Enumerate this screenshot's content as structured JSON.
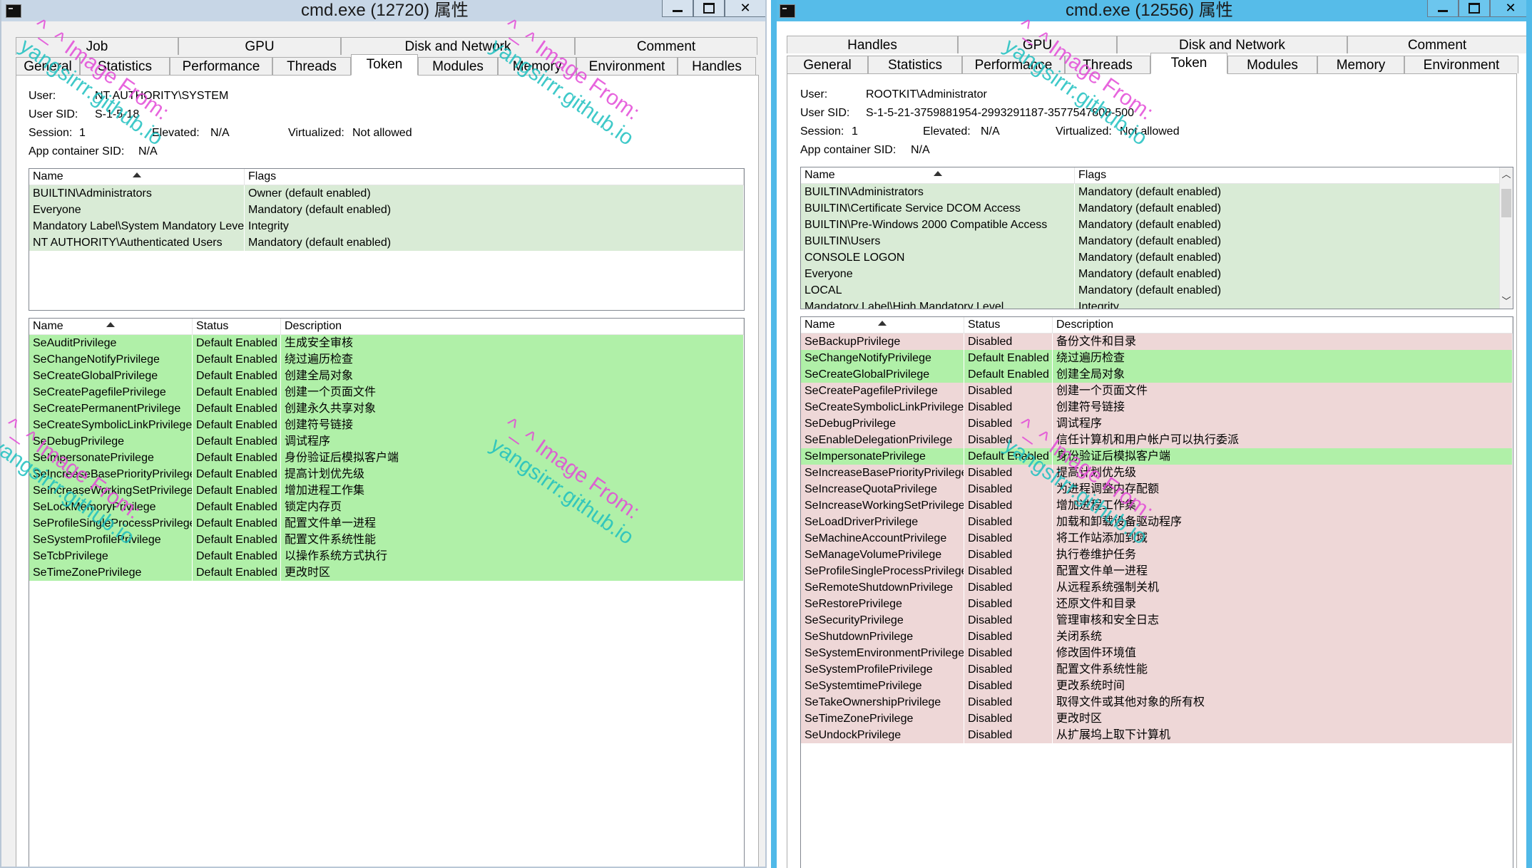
{
  "left": {
    "title": "cmd.exe (12720) 属性",
    "tabs_top": [
      "Job",
      "GPU",
      "Disk and Network",
      "Comment"
    ],
    "tabs_bottom": [
      "General",
      "Statistics",
      "Performance",
      "Threads",
      "Token",
      "Modules",
      "Memory",
      "Environment",
      "Handles"
    ],
    "active_tab": "Token",
    "user_label": "User:",
    "user_value": "NT AUTHORITY\\SYSTEM",
    "sid_label": "User SID:",
    "sid_value": "S-1-5-18",
    "session_label": "Session:",
    "session_value": "1",
    "elevated_label": "Elevated:",
    "elevated_value": "N/A",
    "virtualized_label": "Virtualized:",
    "virtualized_value": "Not allowed",
    "appsid_label": "App container SID:",
    "appsid_value": "N/A",
    "groups": {
      "headers": [
        "Name",
        "Flags"
      ],
      "rows": [
        {
          "name": "BUILTIN\\Administrators",
          "flags": "Owner (default enabled)"
        },
        {
          "name": "Everyone",
          "flags": "Mandatory (default enabled)"
        },
        {
          "name": "Mandatory Label\\System Mandatory Level",
          "flags": "Integrity"
        },
        {
          "name": "NT AUTHORITY\\Authenticated Users",
          "flags": "Mandatory (default enabled)"
        }
      ]
    },
    "privileges": {
      "headers": [
        "Name",
        "Status",
        "Description"
      ],
      "rows": [
        {
          "name": "SeAuditPrivilege",
          "status": "Default Enabled",
          "desc": "生成安全审核",
          "state": "enabled"
        },
        {
          "name": "SeChangeNotifyPrivilege",
          "status": "Default Enabled",
          "desc": "绕过遍历检查",
          "state": "enabled"
        },
        {
          "name": "SeCreateGlobalPrivilege",
          "status": "Default Enabled",
          "desc": "创建全局对象",
          "state": "enabled"
        },
        {
          "name": "SeCreatePagefilePrivilege",
          "status": "Default Enabled",
          "desc": "创建一个页面文件",
          "state": "enabled"
        },
        {
          "name": "SeCreatePermanentPrivilege",
          "status": "Default Enabled",
          "desc": "创建永久共享对象",
          "state": "enabled"
        },
        {
          "name": "SeCreateSymbolicLinkPrivilege",
          "status": "Default Enabled",
          "desc": "创建符号链接",
          "state": "enabled"
        },
        {
          "name": "SeDebugPrivilege",
          "status": "Default Enabled",
          "desc": "调试程序",
          "state": "enabled"
        },
        {
          "name": "SeImpersonatePrivilege",
          "status": "Default Enabled",
          "desc": "身份验证后模拟客户端",
          "state": "enabled"
        },
        {
          "name": "SeIncreaseBasePriorityPrivilege",
          "status": "Default Enabled",
          "desc": "提高计划优先级",
          "state": "enabled"
        },
        {
          "name": "SeIncreaseWorkingSetPrivilege",
          "status": "Default Enabled",
          "desc": "增加进程工作集",
          "state": "enabled"
        },
        {
          "name": "SeLockMemoryPrivilege",
          "status": "Default Enabled",
          "desc": "锁定内存页",
          "state": "enabled"
        },
        {
          "name": "SeProfileSingleProcessPrivilege",
          "status": "Default Enabled",
          "desc": "配置文件单一进程",
          "state": "enabled"
        },
        {
          "name": "SeSystemProfilePrivilege",
          "status": "Default Enabled",
          "desc": "配置文件系统性能",
          "state": "enabled"
        },
        {
          "name": "SeTcbPrivilege",
          "status": "Default Enabled",
          "desc": "以操作系统方式执行",
          "state": "enabled"
        },
        {
          "name": "SeTimeZonePrivilege",
          "status": "Default Enabled",
          "desc": "更改时区",
          "state": "enabled"
        }
      ]
    }
  },
  "right": {
    "title": "cmd.exe (12556) 属性",
    "tabs_top": [
      "Handles",
      "GPU",
      "Disk and Network",
      "Comment"
    ],
    "tabs_bottom": [
      "General",
      "Statistics",
      "Performance",
      "Threads",
      "Token",
      "Modules",
      "Memory",
      "Environment"
    ],
    "active_tab": "Token",
    "user_label": "User:",
    "user_value": "ROOTKIT\\Administrator",
    "sid_label": "User SID:",
    "sid_value": "S-1-5-21-3759881954-2993291187-3577547808-500",
    "session_label": "Session:",
    "session_value": "1",
    "elevated_label": "Elevated:",
    "elevated_value": "N/A",
    "virtualized_label": "Virtualized:",
    "virtualized_value": "Not allowed",
    "appsid_label": "App container SID:",
    "appsid_value": "N/A",
    "groups": {
      "headers": [
        "Name",
        "Flags"
      ],
      "rows": [
        {
          "name": "BUILTIN\\Administrators",
          "flags": "Mandatory (default enabled)"
        },
        {
          "name": "BUILTIN\\Certificate Service DCOM Access",
          "flags": "Mandatory (default enabled)"
        },
        {
          "name": "BUILTIN\\Pre-Windows 2000 Compatible Access",
          "flags": "Mandatory (default enabled)"
        },
        {
          "name": "BUILTIN\\Users",
          "flags": "Mandatory (default enabled)"
        },
        {
          "name": "CONSOLE LOGON",
          "flags": "Mandatory (default enabled)"
        },
        {
          "name": "Everyone",
          "flags": "Mandatory (default enabled)"
        },
        {
          "name": "LOCAL",
          "flags": "Mandatory (default enabled)"
        },
        {
          "name": "Mandatory Label\\High Mandatory Level",
          "flags": "Integrity"
        }
      ]
    },
    "privileges": {
      "headers": [
        "Name",
        "Status",
        "Description"
      ],
      "rows": [
        {
          "name": "SeBackupPrivilege",
          "status": "Disabled",
          "desc": "备份文件和目录",
          "state": "disabled"
        },
        {
          "name": "SeChangeNotifyPrivilege",
          "status": "Default Enabled",
          "desc": "绕过遍历检查",
          "state": "enabled"
        },
        {
          "name": "SeCreateGlobalPrivilege",
          "status": "Default Enabled",
          "desc": "创建全局对象",
          "state": "enabled"
        },
        {
          "name": "SeCreatePagefilePrivilege",
          "status": "Disabled",
          "desc": "创建一个页面文件",
          "state": "disabled"
        },
        {
          "name": "SeCreateSymbolicLinkPrivilege",
          "status": "Disabled",
          "desc": "创建符号链接",
          "state": "disabled"
        },
        {
          "name": "SeDebugPrivilege",
          "status": "Disabled",
          "desc": "调试程序",
          "state": "disabled"
        },
        {
          "name": "SeEnableDelegationPrivilege",
          "status": "Disabled",
          "desc": "信任计算机和用户帐户可以执行委派",
          "state": "disabled"
        },
        {
          "name": "SeImpersonatePrivilege",
          "status": "Default Enabled",
          "desc": "身份验证后模拟客户端",
          "state": "enabled"
        },
        {
          "name": "SeIncreaseBasePriorityPrivilege",
          "status": "Disabled",
          "desc": "提高计划优先级",
          "state": "disabled"
        },
        {
          "name": "SeIncreaseQuotaPrivilege",
          "status": "Disabled",
          "desc": "为进程调整内存配额",
          "state": "disabled"
        },
        {
          "name": "SeIncreaseWorkingSetPrivilege",
          "status": "Disabled",
          "desc": "增加进程工作集",
          "state": "disabled"
        },
        {
          "name": "SeLoadDriverPrivilege",
          "status": "Disabled",
          "desc": "加载和卸载设备驱动程序",
          "state": "disabled"
        },
        {
          "name": "SeMachineAccountPrivilege",
          "status": "Disabled",
          "desc": "将工作站添加到域",
          "state": "disabled"
        },
        {
          "name": "SeManageVolumePrivilege",
          "status": "Disabled",
          "desc": "执行卷维护任务",
          "state": "disabled"
        },
        {
          "name": "SeProfileSingleProcessPrivilege",
          "status": "Disabled",
          "desc": "配置文件单一进程",
          "state": "disabled"
        },
        {
          "name": "SeRemoteShutdownPrivilege",
          "status": "Disabled",
          "desc": "从远程系统强制关机",
          "state": "disabled"
        },
        {
          "name": "SeRestorePrivilege",
          "status": "Disabled",
          "desc": "还原文件和目录",
          "state": "disabled"
        },
        {
          "name": "SeSecurityPrivilege",
          "status": "Disabled",
          "desc": "管理审核和安全日志",
          "state": "disabled"
        },
        {
          "name": "SeShutdownPrivilege",
          "status": "Disabled",
          "desc": "关闭系统",
          "state": "disabled"
        },
        {
          "name": "SeSystemEnvironmentPrivilege",
          "status": "Disabled",
          "desc": "修改固件环境值",
          "state": "disabled"
        },
        {
          "name": "SeSystemProfilePrivilege",
          "status": "Disabled",
          "desc": "配置文件系统性能",
          "state": "disabled"
        },
        {
          "name": "SeSystemtimePrivilege",
          "status": "Disabled",
          "desc": "更改系统时间",
          "state": "disabled"
        },
        {
          "name": "SeTakeOwnershipPrivilege",
          "status": "Disabled",
          "desc": "取得文件或其他对象的所有权",
          "state": "disabled"
        },
        {
          "name": "SeTimeZonePrivilege",
          "status": "Disabled",
          "desc": "更改时区",
          "state": "disabled"
        },
        {
          "name": "SeUndockPrivilege",
          "status": "Disabled",
          "desc": "从扩展坞上取下计算机",
          "state": "disabled"
        }
      ]
    }
  },
  "watermark": {
    "line1": "^_^ Image From:",
    "line2": "yangsirrr.github.io"
  },
  "colors": {
    "enabled": "#b0f0a8",
    "disabled": "#eed7d7",
    "group": "#d9ebd6",
    "watermark_pink": "#e34ad8",
    "watermark_cyan": "#1ec0c0",
    "title_right": "#56bce9"
  }
}
